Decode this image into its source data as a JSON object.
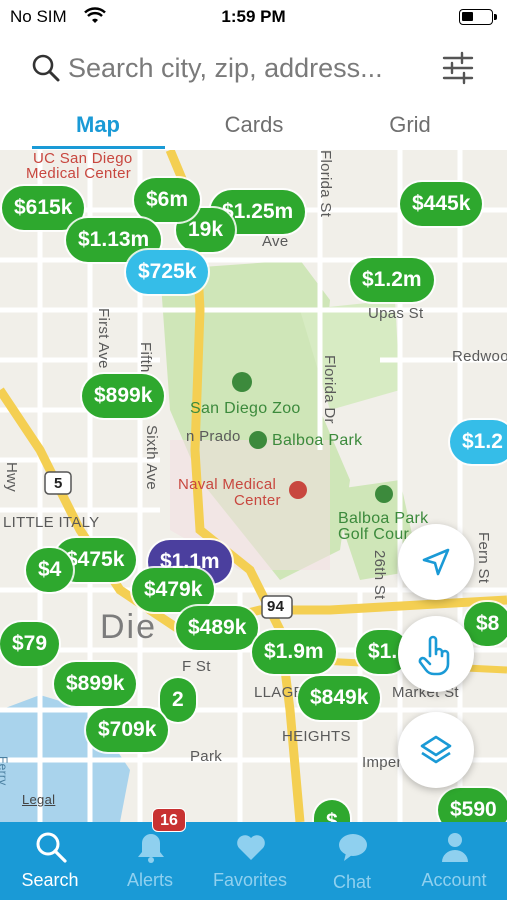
{
  "status_bar": {
    "carrier": "No SIM",
    "time": "1:59 PM"
  },
  "search": {
    "placeholder": "Search city, zip, address..."
  },
  "tabs": [
    {
      "label": "Map"
    },
    {
      "label": "Cards"
    },
    {
      "label": "Grid"
    }
  ],
  "map_labels": {
    "ucsd": "UC San Diego",
    "ucsd2": "Medical Center",
    "florida_st": "Florida St",
    "florida_dr": "Florida Dr",
    "first_ave": "First Ave",
    "fifth_ave": "Fifth Ave",
    "sixth_ave": "Sixth Ave",
    "zoo": "San Diego Zoo",
    "balboa": "Balboa Park",
    "prado": "n Prado",
    "naval": "Naval Medical",
    "naval2": "Center",
    "golf": "Balboa Park",
    "golf2": "Golf Cour",
    "little_italy": "LITTLE ITALY",
    "redwood": "Redwood",
    "upas": "Upas St",
    "ave": "Ave",
    "hwy": "Hwy",
    "fern": "Fern St",
    "st26": "26th St",
    "diego": "Die",
    "f_st": "F St",
    "market": "Market St",
    "heights": "HEIGHTS",
    "lage": "LLAGE",
    "imper": "Imper",
    "park": "Park",
    "shield5": "5",
    "shield94": "94",
    "legal": "Legal",
    "ferry": "Ferry"
  },
  "pins": [
    {
      "label": "$615k",
      "color": "green"
    },
    {
      "label": "$6m",
      "color": "green"
    },
    {
      "label": "$1.25m",
      "color": "green"
    },
    {
      "label": "$445k",
      "color": "green"
    },
    {
      "label": "19k",
      "color": "green"
    },
    {
      "label": "$1.13m",
      "color": "green"
    },
    {
      "label": "$725k",
      "color": "blue"
    },
    {
      "label": "$1.2m",
      "color": "green"
    },
    {
      "label": "$899k",
      "color": "green"
    },
    {
      "label": "$1.2",
      "color": "blue"
    },
    {
      "label": "$475k",
      "color": "green"
    },
    {
      "label": "$1.1m",
      "color": "purple"
    },
    {
      "label": "$479k",
      "color": "green"
    },
    {
      "label": "$489k",
      "color": "green"
    },
    {
      "label": "$79",
      "color": "green"
    },
    {
      "label": "$1.9m",
      "color": "green"
    },
    {
      "label": "$1.",
      "color": "green"
    },
    {
      "label": "$8",
      "color": "green"
    },
    {
      "label": "$899k",
      "color": "green"
    },
    {
      "label": "2",
      "color": "green"
    },
    {
      "label": "$849k",
      "color": "green"
    },
    {
      "label": "$709k",
      "color": "green"
    },
    {
      "label": "$590",
      "color": "green"
    },
    {
      "label": "$4",
      "color": "green"
    },
    {
      "label": "$",
      "color": "green"
    }
  ],
  "nav": [
    {
      "label": "Search",
      "icon": "search-icon",
      "active": true
    },
    {
      "label": "Alerts",
      "icon": "bell-icon",
      "badge": "16"
    },
    {
      "label": "Favorites",
      "icon": "heart-icon"
    },
    {
      "label": "Chat",
      "icon": "chat-icon"
    },
    {
      "label": "Account",
      "icon": "person-icon"
    }
  ],
  "colors": {
    "accent": "#1a9ad6",
    "pin_green": "#2ea82e",
    "pin_blue": "#35bde8",
    "pin_purple": "#4b3f9e",
    "badge": "#c83232"
  }
}
